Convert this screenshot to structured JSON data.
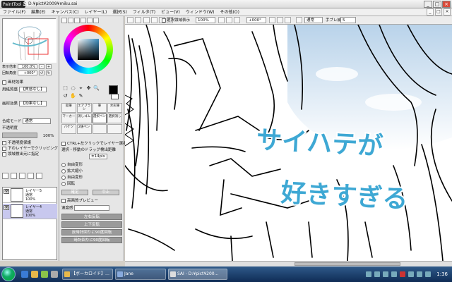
{
  "app": {
    "logo_small": "PaintTool",
    "logo_big": "SAI",
    "window_title": "D:¥pict¥2009¥miku.sai"
  },
  "menu": [
    "ファイル(F)",
    "編集(E)",
    "キャンバス(C)",
    "レイヤー(L)",
    "選択(S)",
    "フィルタ(T)",
    "ビュー(V)",
    "ウィンドウ(W)",
    "その他(O)"
  ],
  "menu_right": [
    "_",
    "□",
    "×"
  ],
  "window_buttons": [
    "_",
    "□",
    "×"
  ],
  "navigator": {
    "zoom_label": "表示倍率",
    "zoom_value": "100.0%",
    "rotate_label": "回転角度",
    "rotate_value": "+000°"
  },
  "layer_effects": {
    "heading": "画材効果",
    "paper_label": "用紙質感",
    "paper_value": "【質感なし】",
    "effect_label": "画材効果",
    "effect_value": "【効果なし】",
    "blend_label": "合成モード",
    "blend_value": "通常",
    "opacity_label": "不透明度",
    "opacity_value": "100%",
    "protect_label": "不透明度保護",
    "clip_label": "下のレイヤーでクリッピング",
    "source_label": "領域検出元に指定"
  },
  "layers": [
    {
      "name": "レイヤー5",
      "mode": "通常",
      "opacity": "100%"
    },
    {
      "name": "レイヤー4",
      "mode": "通常",
      "opacity": "100%"
    }
  ],
  "tools": {
    "selection_icons": [
      "⬚",
      "◌",
      "⌖",
      "✥",
      "🔍",
      "↺",
      "✋",
      "✎"
    ],
    "grid": [
      "鉛筆",
      "エアブラシ",
      "筆",
      "水彩筆",
      "マーカー",
      "消しゴム",
      "選択ペン",
      "選択消し",
      "バケツ",
      "2値ペン",
      "",
      ""
    ],
    "ctrl_label": "CTRL+左クリックでレイヤー選択",
    "move_label": "選択・移動のドラッグ検出距離",
    "move_value": "±14pix",
    "transforms": [
      "自由変形",
      "拡大縮小",
      "自由変形",
      "回転"
    ],
    "ok_label": "確定",
    "cancel_label": "中止",
    "preview_label": "高画質プレビュー",
    "smooth_label": "速度感",
    "flip_h": "左右反転",
    "flip_v": "上下反転",
    "rot_ccw": "反時計回りに90度回転",
    "rot_cw": "時計回りに90度回転"
  },
  "canvas_toolbar": {
    "selection_view": "選択領域表示",
    "zoom": "100%",
    "angle": "+000°",
    "blend": "通常",
    "stabilizer_label": "手ブレ補正",
    "stabilizer_value": "5"
  },
  "overlay_text": {
    "line1": "サイハテが",
    "line2": "好きすぎる"
  },
  "colors": {
    "overlay_blue": "#3ea8d4",
    "overlay_outline": "#ffffff"
  },
  "taskbar": {
    "tasks": [
      {
        "label": "【ボーカロイド】…"
      },
      {
        "label": "Jane"
      },
      {
        "label": "SAI - D:¥pict¥200…"
      }
    ],
    "clock": "1:36"
  }
}
